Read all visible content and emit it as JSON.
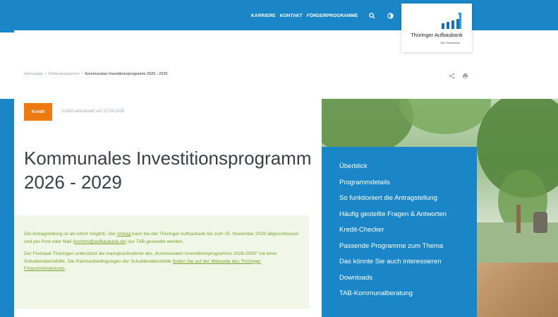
{
  "header": {
    "nav": [
      "KARRIERE",
      "KONTAKT",
      "FÖRDERPROGRAMME"
    ],
    "icons": [
      "search-icon",
      "contrast-icon"
    ],
    "logo": {
      "name": "Thüringer Aufbaubank",
      "tagline": "Die Förderbank."
    }
  },
  "breadcrumb": {
    "items": [
      "Homepage",
      "Förderprogramme",
      "Kommunales Investitionsprogramm 2026 - 2029"
    ],
    "separator": "/"
  },
  "tools": [
    "share-icon",
    "print-icon"
  ],
  "article": {
    "badge": "Kredit",
    "updated": "zuletzt aktualisiert am 23.04.2026",
    "title": "Kommunales Investitionsprogramm 2026 - 2029",
    "notice": {
      "p1_a": "Die Antragstellung ist ab sofort möglich. Der ",
      "p1_link1": "Antrag",
      "p1_b": " kann bei der Thüringer Aufbaubank bis zum 15. November 2029 abgeschlossen und per Post oder Mail (",
      "p1_link2": "kominv@aufbaubank.de",
      "p1_c": ") zur TAB gesendet werden.",
      "p2_a": "Der Freistaat Thüringen unterstützt die Inanspruchnahme des „Kommunalen Investitionsprogramms 2026-2029“ mit einer Schuldendiensthilfe. Die Rahmenbedingungen der Schuldendiensthilfe ",
      "p2_link": "finden Sie auf der Webseite des Thüringer Finanzministeriums",
      "p2_b": "."
    }
  },
  "sidenav": {
    "items": [
      "Überblick",
      "Programmdetails",
      "So funktioniert die Antragstellung",
      "Häufig gestellte Fragen & Antworten",
      "Kredit-Checker",
      "Passende Programme zum Thema",
      "Das könnte Sie auch interessieren",
      "Downloads",
      "TAB-Kommunalberatung"
    ]
  },
  "colors": {
    "brand_blue": "#1a86c7",
    "badge_orange": "#ec7a10",
    "notice_bg": "#f1f7e6",
    "notice_text": "#78a32a"
  }
}
